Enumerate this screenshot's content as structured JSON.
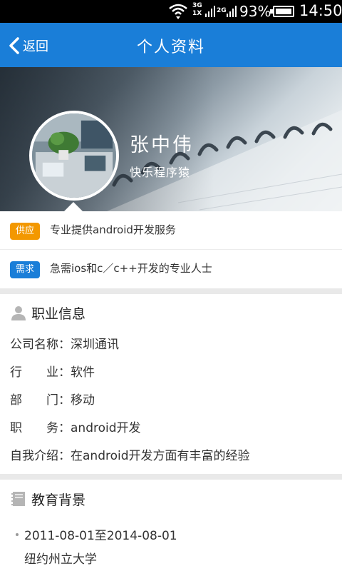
{
  "status_bar": {
    "net_top": "3G",
    "net_mid": "1X",
    "net_alt": "2G",
    "battery": "93%",
    "time": "14:50"
  },
  "nav": {
    "back_label": "返回",
    "title": "个人资料"
  },
  "profile": {
    "name": "张中伟",
    "signature": "快乐程序猿"
  },
  "supply": {
    "tag": "供应",
    "text": "专业提供android开发服务"
  },
  "demand": {
    "tag": "需求",
    "text": "急需ios和c／c++开发的专业人士"
  },
  "career": {
    "heading": "职业信息",
    "rows": [
      "公司名称：深圳通讯",
      "行　　业：软件",
      "部　　门：移动",
      "职　　务：android开发",
      "自我介绍：在android开发方面有丰富的经验"
    ]
  },
  "education": {
    "heading": "教育背景",
    "period": "2011-08-01至2014-08-01",
    "school": "纽约州立大学"
  },
  "colors": {
    "accent": "#1a7ed8",
    "supply_tag": "#f39800",
    "demand_tag": "#1a7ed8"
  }
}
